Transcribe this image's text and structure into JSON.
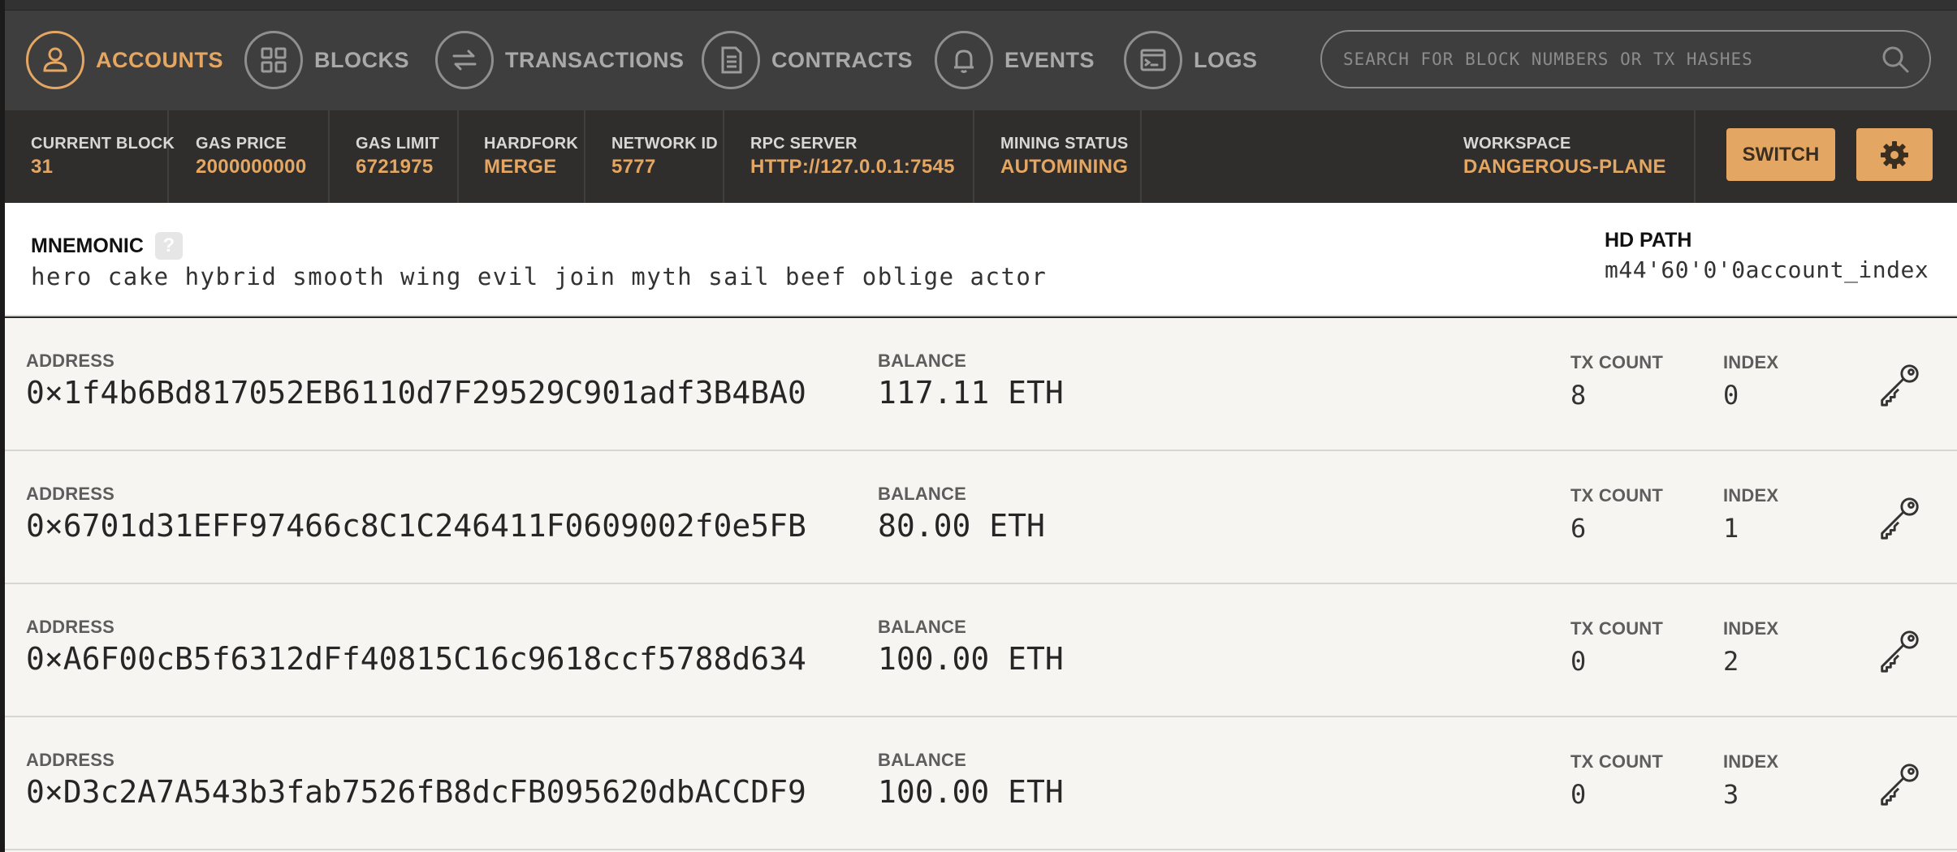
{
  "nav": {
    "items": [
      {
        "label": "ACCOUNTS",
        "icon": "user-icon",
        "active": true
      },
      {
        "label": "BLOCKS",
        "icon": "grid-icon",
        "active": false
      },
      {
        "label": "TRANSACTIONS",
        "icon": "swap-arrows-icon",
        "active": false
      },
      {
        "label": "CONTRACTS",
        "icon": "document-icon",
        "active": false
      },
      {
        "label": "EVENTS",
        "icon": "bell-icon",
        "active": false
      },
      {
        "label": "LOGS",
        "icon": "terminal-icon",
        "active": false
      }
    ],
    "search": {
      "placeholder": "SEARCH FOR BLOCK NUMBERS OR TX HASHES"
    }
  },
  "status": {
    "current_block": {
      "label": "CURRENT BLOCK",
      "value": "31"
    },
    "gas_price": {
      "label": "GAS PRICE",
      "value": "2000000000"
    },
    "gas_limit": {
      "label": "GAS LIMIT",
      "value": "6721975"
    },
    "hardfork": {
      "label": "HARDFORK",
      "value": "MERGE"
    },
    "network_id": {
      "label": "NETWORK ID",
      "value": "5777"
    },
    "rpc_server": {
      "label": "RPC SERVER",
      "value": "HTTP://127.0.0.1:7545"
    },
    "mining_status": {
      "label": "MINING STATUS",
      "value": "AUTOMINING"
    },
    "workspace": {
      "label": "WORKSPACE",
      "value": "DANGEROUS-PLANE"
    },
    "switch_label": "SWITCH"
  },
  "mnemonic": {
    "title": "MNEMONIC",
    "help": "?",
    "words": "hero cake hybrid smooth wing evil join myth sail beef oblige actor",
    "hd_path_label": "HD PATH",
    "hd_path_value": "m44'60'0'0account_index"
  },
  "accounts": {
    "labels": {
      "address": "ADDRESS",
      "balance": "BALANCE",
      "tx_count": "TX COUNT",
      "index": "INDEX"
    },
    "rows": [
      {
        "address": "0×1f4b6Bd817052EB6110d7F29529C901adf3B4BA0",
        "balance": "117.11 ETH",
        "tx_count": "8",
        "index": "0"
      },
      {
        "address": "0×6701d31EFF97466c8C1C246411F0609002f0e5FB",
        "balance": "80.00 ETH",
        "tx_count": "6",
        "index": "1"
      },
      {
        "address": "0×A6F00cB5f6312dFf40815C16c9618ccf5788d634",
        "balance": "100.00 ETH",
        "tx_count": "0",
        "index": "2"
      },
      {
        "address": "0×D3c2A7A543b3fab7526fB8dcFB095620dbACCDF9",
        "balance": "100.00 ETH",
        "tx_count": "0",
        "index": "3"
      }
    ]
  },
  "colors": {
    "accent": "#e4a663",
    "nav_bg": "#3e3e3e",
    "status_bg": "#2f2e2c"
  }
}
